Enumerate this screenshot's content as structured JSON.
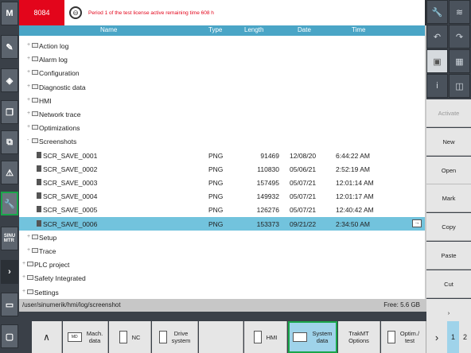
{
  "header": {
    "alarm_number": "8084",
    "message": "Period 1 of the test license active remaining time 608 h"
  },
  "columns": [
    "Name",
    "Type",
    "Length",
    "Date",
    "Time"
  ],
  "tree": [
    {
      "name": "Action log",
      "kind": "folder",
      "level": 1,
      "exp": "+"
    },
    {
      "name": "Alarm log",
      "kind": "folder",
      "level": 1,
      "exp": "+"
    },
    {
      "name": "Configuration",
      "kind": "folder",
      "level": 1,
      "exp": "+"
    },
    {
      "name": "Diagnostic data",
      "kind": "folder",
      "level": 1,
      "exp": "+"
    },
    {
      "name": "HMI",
      "kind": "folder",
      "level": 1,
      "exp": "+"
    },
    {
      "name": "Network trace",
      "kind": "folder",
      "level": 1,
      "exp": "+"
    },
    {
      "name": "Optimizations",
      "kind": "folder",
      "level": 1,
      "exp": "+"
    },
    {
      "name": "Screenshots",
      "kind": "folder",
      "level": 1,
      "exp": "-"
    },
    {
      "name": "SCR_SAVE_0001",
      "kind": "file",
      "level": 2,
      "type": "PNG",
      "length": "91469",
      "date": "12/08/20",
      "time": "6:44:22 AM"
    },
    {
      "name": "SCR_SAVE_0002",
      "kind": "file",
      "level": 2,
      "type": "PNG",
      "length": "110830",
      "date": "05/06/21",
      "time": "2:52:19 AM"
    },
    {
      "name": "SCR_SAVE_0003",
      "kind": "file",
      "level": 2,
      "type": "PNG",
      "length": "157495",
      "date": "05/07/21",
      "time": "12:01:14 AM"
    },
    {
      "name": "SCR_SAVE_0004",
      "kind": "file",
      "level": 2,
      "type": "PNG",
      "length": "149932",
      "date": "05/07/21",
      "time": "12:01:17 AM"
    },
    {
      "name": "SCR_SAVE_0005",
      "kind": "file",
      "level": 2,
      "type": "PNG",
      "length": "126276",
      "date": "05/07/21",
      "time": "12:40:42 AM"
    },
    {
      "name": "SCR_SAVE_0006",
      "kind": "file",
      "level": 2,
      "type": "PNG",
      "length": "153373",
      "date": "09/21/22",
      "time": "2:34:50 AM",
      "selected": true
    },
    {
      "name": "Setup",
      "kind": "folder",
      "level": 1,
      "exp": "+"
    },
    {
      "name": "Trace",
      "kind": "folder",
      "level": 1,
      "exp": "+"
    },
    {
      "name": "PLC project",
      "kind": "folder",
      "level": 0,
      "exp": "+"
    },
    {
      "name": "Safety Integrated",
      "kind": "folder",
      "level": 0,
      "exp": "+"
    },
    {
      "name": "Settings",
      "kind": "folder",
      "level": 0,
      "exp": "+"
    }
  ],
  "status": {
    "path": "/user/sinumerik/hmi/log/screenshot",
    "free": "Free: 5.6 GB"
  },
  "softkeys": [
    "Activate",
    "New",
    "Open",
    "Mark",
    "Copy",
    "Paste",
    "Cut"
  ],
  "left_labels": {
    "m": "M",
    "sinu": "SINU\nMTR"
  },
  "bottom": {
    "mach_data": "Mach.\ndata",
    "nc": "NC",
    "drive_system": "Drive\nsystem",
    "hmi": "HMI",
    "system_data": "System\ndata",
    "trakmt_options": "TrakMT\nOptions",
    "optim_test": "Optim./\ntest",
    "md_icon": "MD"
  },
  "pages": [
    "1",
    "2"
  ],
  "colors": {
    "accent": "#4aa5c6",
    "selected": "#72c3dd",
    "alarm": "#e3051b",
    "active_border": "#1aa64a"
  }
}
